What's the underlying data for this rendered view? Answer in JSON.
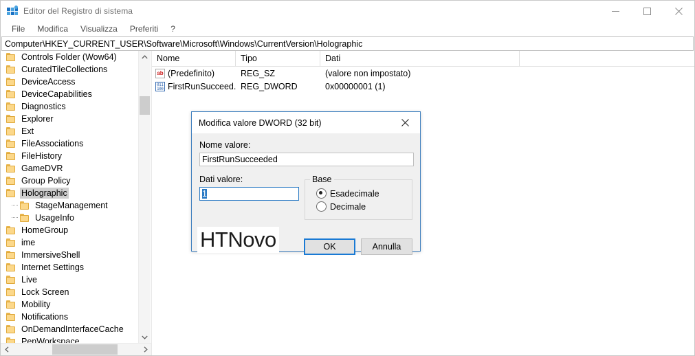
{
  "window": {
    "title": "Editor del Registro di sistema",
    "icon": "registry-editor-icon",
    "minimize_label": "Riduci a icona",
    "maximize_label": "Ingrandisci",
    "close_label": "Chiudi"
  },
  "menubar": {
    "items": [
      {
        "label": "File"
      },
      {
        "label": "Modifica"
      },
      {
        "label": "Visualizza"
      },
      {
        "label": "Preferiti"
      },
      {
        "label": "?"
      }
    ]
  },
  "address": {
    "path": "Computer\\HKEY_CURRENT_USER\\Software\\Microsoft\\Windows\\CurrentVersion\\Holographic"
  },
  "tree": {
    "items": [
      {
        "label": "Controls Folder (Wow64)",
        "level": 0,
        "selected": false
      },
      {
        "label": "CuratedTileCollections",
        "level": 0,
        "selected": false
      },
      {
        "label": "DeviceAccess",
        "level": 0,
        "selected": false
      },
      {
        "label": "DeviceCapabilities",
        "level": 0,
        "selected": false
      },
      {
        "label": "Diagnostics",
        "level": 0,
        "selected": false
      },
      {
        "label": "Explorer",
        "level": 0,
        "selected": false
      },
      {
        "label": "Ext",
        "level": 0,
        "selected": false
      },
      {
        "label": "FileAssociations",
        "level": 0,
        "selected": false
      },
      {
        "label": "FileHistory",
        "level": 0,
        "selected": false
      },
      {
        "label": "GameDVR",
        "level": 0,
        "selected": false
      },
      {
        "label": "Group Policy",
        "level": 0,
        "selected": false
      },
      {
        "label": "Holographic",
        "level": 0,
        "selected": true
      },
      {
        "label": "StageManagement",
        "level": 1,
        "selected": false
      },
      {
        "label": "UsageInfo",
        "level": 1,
        "selected": false
      },
      {
        "label": "HomeGroup",
        "level": 0,
        "selected": false
      },
      {
        "label": "ime",
        "level": 0,
        "selected": false
      },
      {
        "label": "ImmersiveShell",
        "level": 0,
        "selected": false
      },
      {
        "label": "Internet Settings",
        "level": 0,
        "selected": false
      },
      {
        "label": "Live",
        "level": 0,
        "selected": false
      },
      {
        "label": "Lock Screen",
        "level": 0,
        "selected": false
      },
      {
        "label": "Mobility",
        "level": 0,
        "selected": false
      },
      {
        "label": "Notifications",
        "level": 0,
        "selected": false
      },
      {
        "label": "OnDemandInterfaceCache",
        "level": 0,
        "selected": false
      },
      {
        "label": "PenWorkspace",
        "level": 0,
        "selected": false
      }
    ]
  },
  "list": {
    "columns": [
      "Nome",
      "Tipo",
      "Dati"
    ],
    "rows": [
      {
        "icon": "string-value-icon",
        "name": "(Predefinito)",
        "type": "REG_SZ",
        "data": "(valore non impostato)"
      },
      {
        "icon": "dword-value-icon",
        "name": "FirstRunSucceed...",
        "type": "REG_DWORD",
        "data": "0x00000001 (1)"
      }
    ]
  },
  "dialog": {
    "title": "Modifica valore DWORD (32 bit)",
    "value_name_label": "Nome valore:",
    "value_name": "FirstRunSucceeded",
    "value_data_label": "Dati valore:",
    "value_data": "1",
    "base_group_label": "Base",
    "base_options": [
      {
        "label": "Esadecimale",
        "checked": true
      },
      {
        "label": "Decimale",
        "checked": false
      }
    ],
    "ok_label": "OK",
    "cancel_label": "Annulla",
    "close_label": "Chiudi"
  },
  "watermark": {
    "text": "HTNovo"
  },
  "colors": {
    "accent": "#2a7ac4",
    "selection": "#cfcfcf",
    "folder": "#fcd88a",
    "dialog_border": "#3b7dbd"
  }
}
